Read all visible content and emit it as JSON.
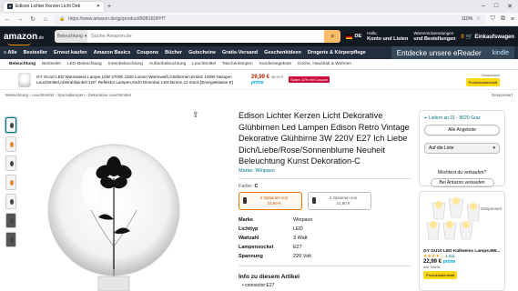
{
  "browser": {
    "tab_title": "Edison Lichter Kerzen Licht Dek",
    "url": "https://www.amazon.de/gp/product/B0B16DPH?",
    "zoom": "110%"
  },
  "header": {
    "logo": "amazon",
    "logo_suffix": ".de",
    "search_category": "Beleuchtung",
    "search_placeholder": "Suche Amazon.de",
    "lang": "DE",
    "account_l1": "Hallo,",
    "account_l2": "Konto und Listen",
    "orders_l1": "Warenrücksendungen",
    "orders_l2": "und Bestellungen",
    "cart_count": "0",
    "cart_label": "Einkaufswagen"
  },
  "nav": {
    "all": "Alle",
    "items": [
      "Bestseller",
      "Erneut kaufen",
      "Amazon Basics",
      "Coupons",
      "Bücher",
      "Gutscheine",
      "Gratis-Versand",
      "Geschenkideen",
      "Drogerie & Körperpflege"
    ],
    "promo": "Entdecke unsere eReader",
    "promo_brand": "kindle"
  },
  "subnav": [
    "Beleuchtung",
    "Bestseller",
    "LED-Beleuchtung",
    "Innenbeleuchtung",
    "Außenbeleuchtung",
    "Leuchtmittel",
    "Taschenlampen",
    "Sonderangebote",
    "Küche, Haushalt & Wohnen"
  ],
  "ad_banner": {
    "text": "GY GU10 LED Warmweiss Lampe,10W 2700K 1100 Lumen Warmweiß,Glühbirnen,Ersetz 100W Halogen Leuchtmittel,Abstrahlwinkel 120° Reflektor Lampen,Nicht Dimmbar LED Birnen,12 stück [Energieklasse E]",
    "price": "29,99 €",
    "was": "36,99 €",
    "save": "Spare 11% mit Coupon",
    "prime": "prime",
    "button": "Produktdatenblatt",
    "sponsored": "Gesponsert"
  },
  "breadcrumb": "Beleuchtung › Leuchtmittel › Speziallampen › Dekorative Leuchtmittel",
  "breadcrumb_sponsored": "Gesponsert",
  "product": {
    "title": "Edison Lichter Kerzen Licht Dekorative Glühbirnen Led Lampen Edison Retro Vintage Dekorative Glühbirne 3W 220V E27 Ich Liebe Dich/Liebe/Rose/Sonnenblume Neuheit Beleuchtung Kunst Dekoration-C",
    "brand": "Marke: Winpavo",
    "farbe_label": "Farbe:",
    "farbe_value": "C",
    "options": [
      {
        "line1": "2 Optionen von",
        "line2": "21,80 €"
      },
      {
        "line1": "2 Optionen von",
        "line2": "21,80 €"
      }
    ],
    "specs": [
      {
        "k": "Marke",
        "v": "Winpavo"
      },
      {
        "k": "Lichttyp",
        "v": "LED"
      },
      {
        "k": "Wattzahl",
        "v": "3 Watt"
      },
      {
        "k": "Lampensockel",
        "v": "E27"
      },
      {
        "k": "Spannung",
        "v": "220 Volt"
      }
    ],
    "about_title": "Info zu diesem Artikel",
    "about_item": "• connector:E27"
  },
  "buybox": {
    "delivery": "Liefern an 01 - 8020 Graz",
    "all_offers": "Alle Angebote",
    "list": "Auf die Liste",
    "sell_q": "Möchtest du verkaufen?",
    "sell_btn": "Bei Amazon verkaufen"
  },
  "side_ad": {
    "name": "GY GU10 LED Kaltweiss Lampe,8W...",
    "rating_count": "1.611",
    "price": "22,99 €",
    "prime": "prime",
    "tax": "inkl. MwSt.",
    "button": "Produktdatenblatt",
    "sponsored": "Gesponsert"
  }
}
